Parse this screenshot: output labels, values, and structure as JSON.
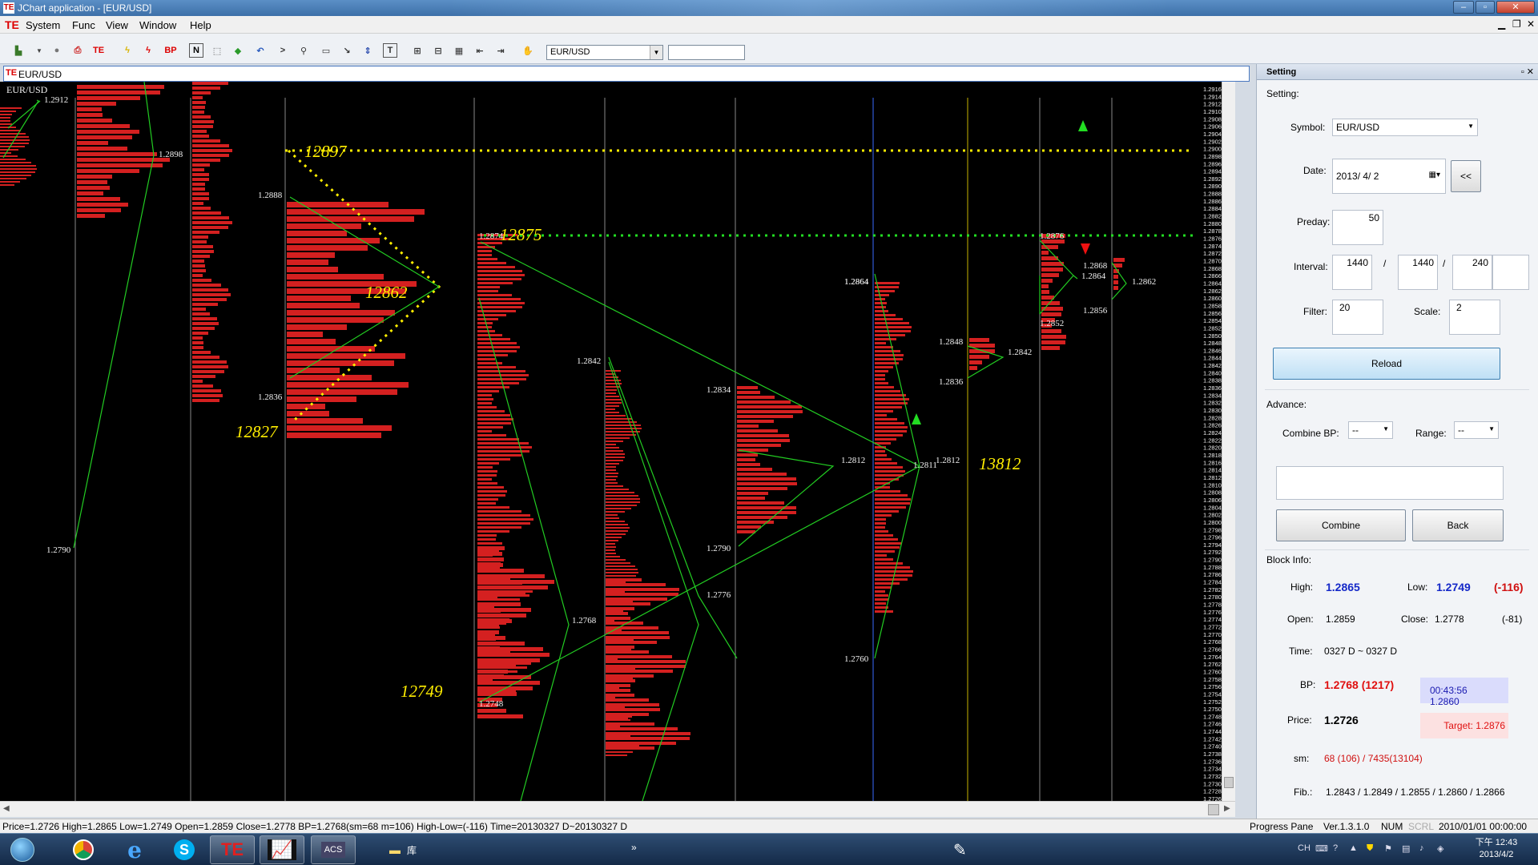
{
  "window": {
    "title": "JChart application - [EUR/USD]"
  },
  "menu": [
    "System",
    "Func",
    "View",
    "Window",
    "Help"
  ],
  "toolbar": {
    "symbol": "EUR/USD"
  },
  "doc_tab": {
    "label": "EUR/USD"
  },
  "chart": {
    "symbol": "EUR/USD",
    "axis_ticks": [
      "1.2916",
      "1.2914",
      "1.2912",
      "1.2910",
      "1.2908",
      "1.2906",
      "1.2904",
      "1.2902",
      "1.2900",
      "1.2898",
      "1.2896",
      "1.2894",
      "1.2892",
      "1.2890",
      "1.2888",
      "1.2886",
      "1.2884",
      "1.2882",
      "1.2880",
      "1.2878",
      "1.2876",
      "1.2874",
      "1.2872",
      "1.2870",
      "1.2868",
      "1.2866",
      "1.2864",
      "1.2862",
      "1.2860",
      "1.2858",
      "1.2856",
      "1.2854",
      "1.2852",
      "1.2850",
      "1.2848",
      "1.2846",
      "1.2844",
      "1.2842",
      "1.2840",
      "1.2838",
      "1.2836",
      "1.2834",
      "1.2832",
      "1.2830",
      "1.2828",
      "1.2826",
      "1.2824",
      "1.2822",
      "1.2820",
      "1.2818",
      "1.2816",
      "1.2814",
      "1.2812",
      "1.2810",
      "1.2808",
      "1.2806",
      "1.2804",
      "1.2802",
      "1.2800",
      "1.2798",
      "1.2796",
      "1.2794",
      "1.2792",
      "1.2790",
      "1.2788",
      "1.2786",
      "1.2784",
      "1.2782",
      "1.2780",
      "1.2778",
      "1.2776",
      "1.2774",
      "1.2772",
      "1.2770",
      "1.2768",
      "1.2766",
      "1.2764",
      "1.2762",
      "1.2760",
      "1.2758",
      "1.2756",
      "1.2754",
      "1.2752",
      "1.2750",
      "1.2748",
      "1.2746",
      "1.2744",
      "1.2742",
      "1.2740",
      "1.2738",
      "1.2736",
      "1.2734",
      "1.2732",
      "1.2730",
      "1.2728",
      "1.2726"
    ],
    "price_labels": [
      "1.2912",
      "1.2898",
      "1.2790",
      "1.2888",
      "1.2836",
      "1.2864",
      "1.2874",
      "1.2768",
      "1.2748",
      "1.2842",
      "1.2776",
      "1.2834",
      "1.2812",
      "1.2790",
      "1.2864",
      "1.2760",
      "1.2811",
      "1.2812",
      "1.2848",
      "1.2836",
      "1.2842",
      "1.2876",
      "1.2852",
      "1.2868",
      "1.2864",
      "1.2856",
      "1.2862"
    ],
    "annotations": [
      "12897",
      "12875",
      "12862",
      "12827",
      "12749",
      "13812"
    ],
    "colors": {
      "background": "#000000",
      "profile": "#d42020",
      "swing": "#22cc22",
      "level_yellow": "#ffee00",
      "level_green": "#22dd22",
      "label": "#f2f2f2",
      "annotation": "#ffee00"
    }
  },
  "settings": {
    "title": "Setting",
    "section_label": "Setting:",
    "symbol_label": "Symbol:",
    "symbol_value": "EUR/USD",
    "date_label": "Date:",
    "date_value": "2013/ 4/ 2",
    "prev_button": "<<",
    "preday_label": "Preday:",
    "preday_value": "50",
    "interval_label": "Interval:",
    "interval_1": "1440",
    "interval_sep1": "/",
    "interval_2": "1440",
    "interval_sep2": "/",
    "interval_3": "240",
    "filter_label": "Filter:",
    "filter_value": "20",
    "scale_label": "Scale:",
    "scale_value": "2",
    "reload_button": "Reload",
    "advance_label": "Advance:",
    "combine_bp_label": "Combine BP:",
    "combine_bp_value": "--",
    "range_label": "Range:",
    "range_value": "--",
    "combine_button": "Combine",
    "back_button": "Back",
    "block_info_label": "Block Info:",
    "high_label": "High:",
    "high_value": "1.2865",
    "low_label": "Low:",
    "low_value": "1.2749",
    "low_diff": "(-116)",
    "open_label": "Open:",
    "open_value": "1.2859",
    "close_label": "Close:",
    "close_value": "1.2778",
    "close_diff": "(-81)",
    "time_label": "Time:",
    "time_value": "0327 D ~ 0327 D",
    "bp_label": "BP:",
    "bp_value": "1.2768 (1217)",
    "bp_time": "00:43:56  1.2860",
    "price_label": "Price:",
    "price_value": "1.2726",
    "target": "Target: 1.2876",
    "sm_label": "sm:",
    "sm_value": "68 (106) / 7435(13104)",
    "fib_label": "Fib.:",
    "fib_value": "1.2843 / 1.2849 / 1.2855 / 1.2860 / 1.2866"
  },
  "status": {
    "main": "Price=1.2726  High=1.2865  Low=1.2749  Open=1.2859  Close=1.2778  BP=1.2768(sm=68 m=106)  High-Low=(-116)  Time=20130327 D~20130327 D",
    "progress": "Progress Pane",
    "version": "Ver.1.3.1.0",
    "num": "NUM",
    "scrl": "SCRL",
    "datetime": "2010/01/01 00:00:00"
  },
  "taskbar": {
    "folder_label": "库",
    "time": "下午 12:43",
    "date": "2013/4/2",
    "ime": "CH"
  }
}
